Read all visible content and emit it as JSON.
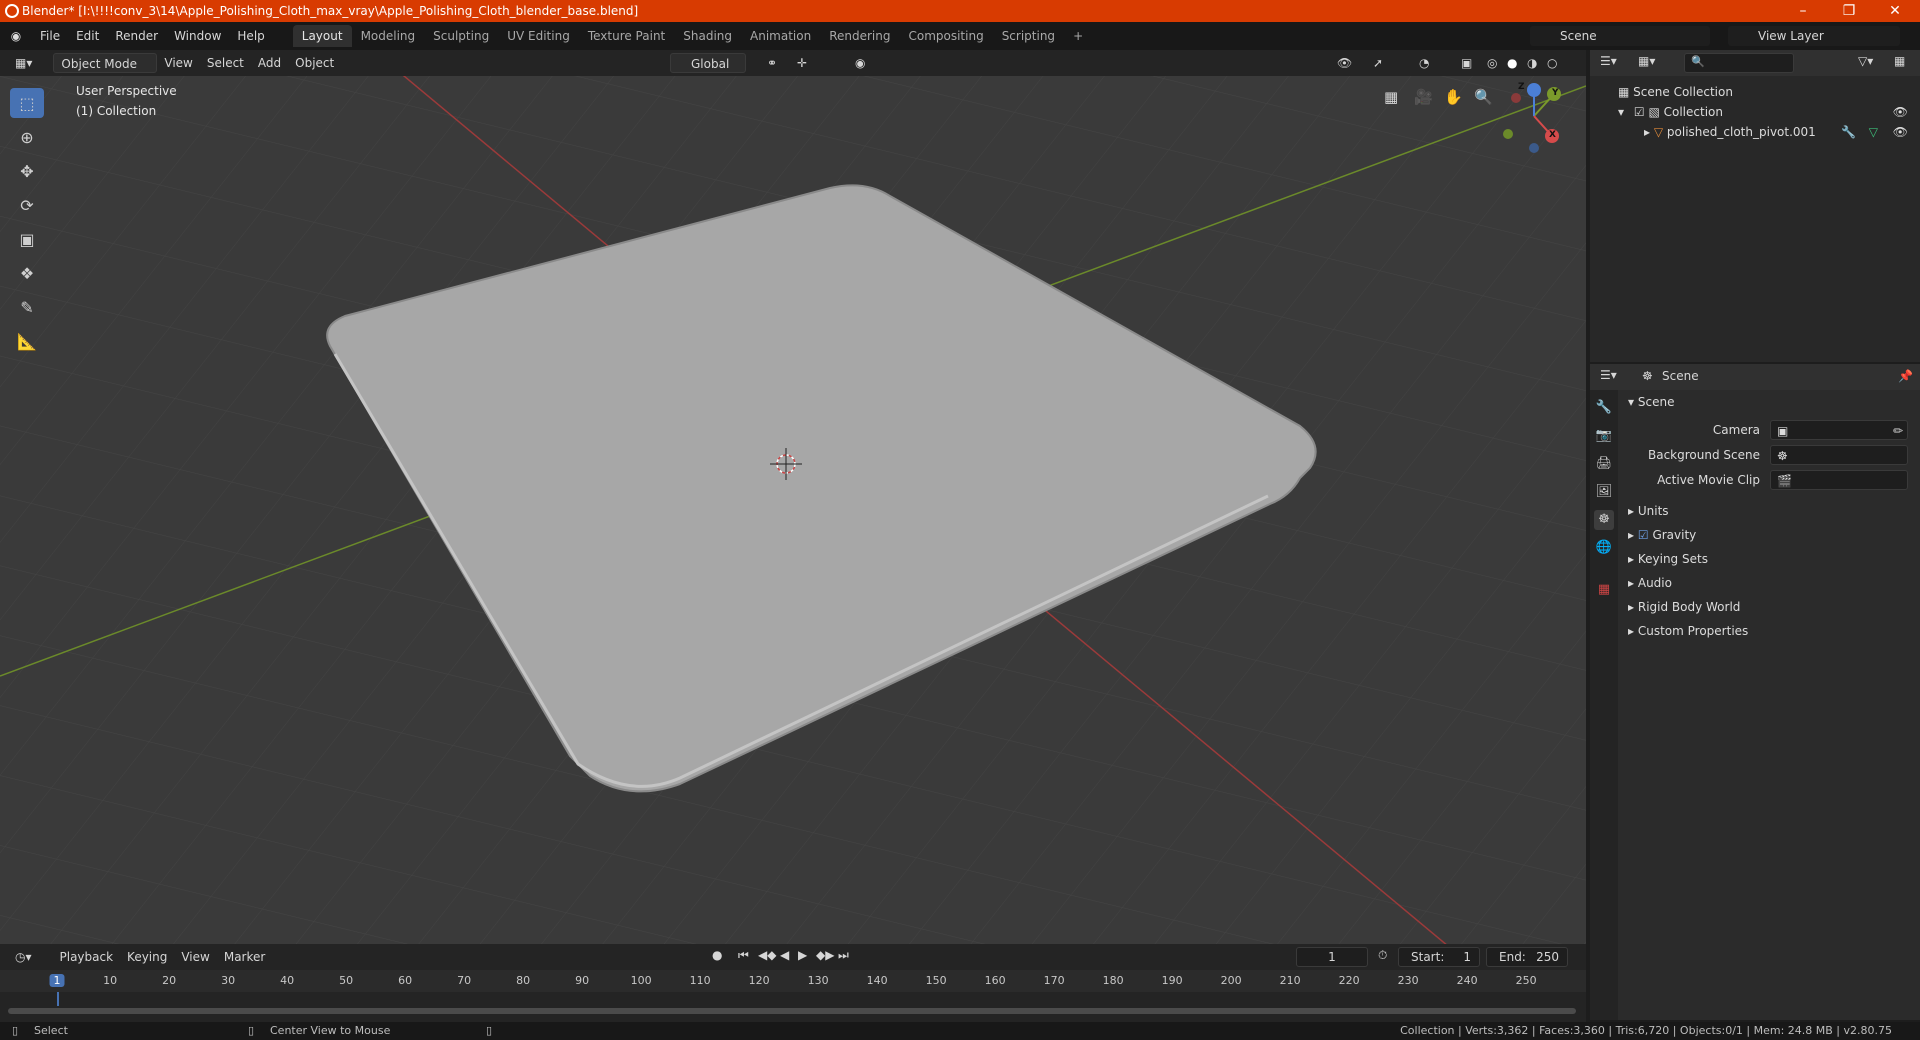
{
  "title": "Blender* [I:\\!!!!conv_3\\14\\Apple_Polishing_Cloth_max_vray\\Apple_Polishing_Cloth_blender_base.blend]",
  "menu": [
    "File",
    "Edit",
    "Render",
    "Window",
    "Help"
  ],
  "workspaces": [
    "Layout",
    "Modeling",
    "Sculpting",
    "UV Editing",
    "Texture Paint",
    "Shading",
    "Animation",
    "Rendering",
    "Compositing",
    "Scripting"
  ],
  "active_workspace": "Layout",
  "scene_name": "Scene",
  "view_layer": "View Layer",
  "viewport_header": {
    "mode": "Object Mode",
    "view": "View",
    "select": "Select",
    "add": "Add",
    "object": "Object",
    "orientation": "Global"
  },
  "viewport": {
    "perspective": "User Perspective",
    "collection": "(1) Collection"
  },
  "gizmo": {
    "x": "X",
    "y": "Y",
    "z": "Z"
  },
  "outliner": {
    "root": "Scene Collection",
    "collection": "Collection",
    "object": "polished_cloth_pivot.001"
  },
  "properties": {
    "context": "Scene",
    "section": "Scene",
    "camera_label": "Camera",
    "bg_scene_label": "Background Scene",
    "movie_clip_label": "Active Movie Clip",
    "panels": [
      "Units",
      "Gravity",
      "Keying Sets",
      "Audio",
      "Rigid Body World",
      "Custom Properties"
    ]
  },
  "timeline": {
    "playback": "Playback",
    "keying": "Keying",
    "view": "View",
    "marker": "Marker",
    "current_frame": "1",
    "start_label": "Start:",
    "start": "1",
    "end_label": "End:",
    "end": "250",
    "ticks": [
      "1",
      "10",
      "20",
      "30",
      "40",
      "50",
      "60",
      "70",
      "80",
      "90",
      "100",
      "110",
      "120",
      "130",
      "140",
      "150",
      "160",
      "170",
      "180",
      "190",
      "200",
      "210",
      "220",
      "230",
      "240",
      "250"
    ]
  },
  "status": {
    "select": "Select",
    "center": "Center View to Mouse",
    "stats": "Collection | Verts:3,362 | Faces:3,360 | Tris:6,720 | Objects:0/1 | Mem: 24.8 MB | v2.80.75"
  },
  "colors": {
    "accent": "#4772b3",
    "titlebar": "#d83b01",
    "x_axis": "#9b3a3a",
    "y_axis": "#6b8a2a"
  }
}
